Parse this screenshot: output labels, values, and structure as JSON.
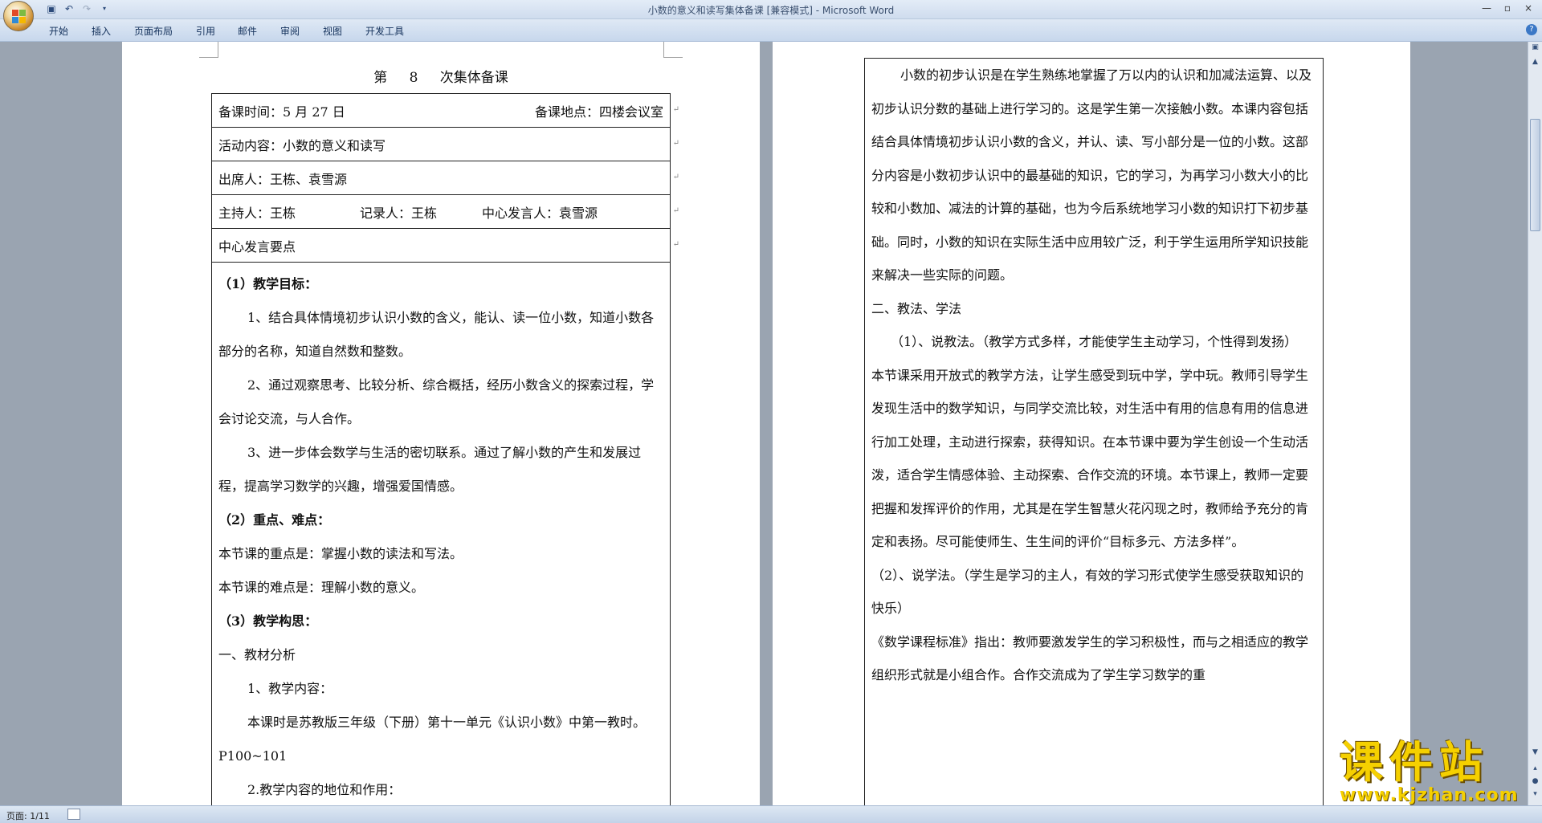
{
  "window": {
    "title": "小数的意义和读写集体备课 [兼容模式] - Microsoft Word",
    "controls": [
      "—",
      "▫",
      "×"
    ]
  },
  "ribbon": {
    "tabs": [
      "开始",
      "插入",
      "页面布局",
      "引用",
      "邮件",
      "审阅",
      "视图",
      "开发工具"
    ]
  },
  "status": {
    "page": "页面: 1/11"
  },
  "watermark": {
    "name": "课件站",
    "url": "www.kjzhan.com"
  },
  "left_page": {
    "heading": "第 8 次集体备课",
    "rows": {
      "time": "备课时间：5 月 27 日",
      "place": "备课地点：四楼会议室",
      "content": "活动内容：小数的意义和读写",
      "attendees": "出席人：王栋、袁雪源",
      "host": "主持人：王栋",
      "recorder": "记录人：王栋",
      "speaker": "中心发言人：袁雪源",
      "key_points": "中心发言要点"
    },
    "paras": {
      "goal_title": "（1）教学目标：",
      "goal1": "1、结合具体情境初步认识小数的含义，能认、读一位小数，知道小数各部分的名称，知道自然数和整数。",
      "goal2": "2、通过观察思考、比较分析、综合概括，经历小数含义的探索过程，学会讨论交流，与人合作。",
      "goal3": "3、进一步体会数学与生活的密切联系。通过了解小数的产生和发展过程，提高学习数学的兴趣，增强爱国情感。",
      "focus_title": "（2）重点、难点：",
      "focus": "本节课的重点是：掌握小数的读法和写法。",
      "difficulty": "本节课的难点是：理解小数的意义。",
      "design_title": "（3）教学构思：",
      "analysis": "一、教材分析",
      "content_title": "1、教学内容：",
      "content": "本课时是苏教版三年级（下册）第十一单元《认识小数》中第一教时。P100~101",
      "position": "2.教学内容的地位和作用："
    }
  },
  "right_page": {
    "p1": "小数的初步认识是在学生熟练地掌握了万以内的认识和加减法运算、以及初步认识分数的基础上进行学习的。这是学生第一次接触小数。本课内容包括结合具体情境初步认识小数的含义，并认、读、写小部分是一位的小数。这部分内容是小数初步认识中的最基础的知识，它的学习，为再学习小数大小的比较和小数加、减法的计算的基础，也为今后系统地学习小数的知识打下初步基础。同时，小数的知识在实际生活中应用较广泛，利于学生运用所学知识技能来解决一些实际的问题。",
    "p2": "二、教法、学法",
    "p3": "（1）、说教法。（教学方式多样，才能使学生主动学习，个性得到发扬）",
    "p4": "本节课采用开放式的教学方法，让学生感受到玩中学，学中玩。教师引导学生发现生活中的数学知识，与同学交流比较，对生活中有用的信息有用的信息进行加工处理，主动进行探索，获得知识。在本节课中要为学生创设一个生动活泼，适合学生情感体验、主动探索、合作交流的环境。本节课上，教师一定要把握和发挥评价的作用，尤其是在学生智慧火花闪现之时，教师给予充分的肯定和表扬。尽可能使师生、生生间的评价“目标多元、方法多样”。",
    "p5": "（2）、说学法。（学生是学习的主人，有效的学习形式使学生感受获取知识的快乐）",
    "p6": "《数学课程标准》指出：教师要激发学生的学习积极性，而与之相适应的教学组织形式就是小组合作。合作交流成为了学生学习数学的重"
  }
}
